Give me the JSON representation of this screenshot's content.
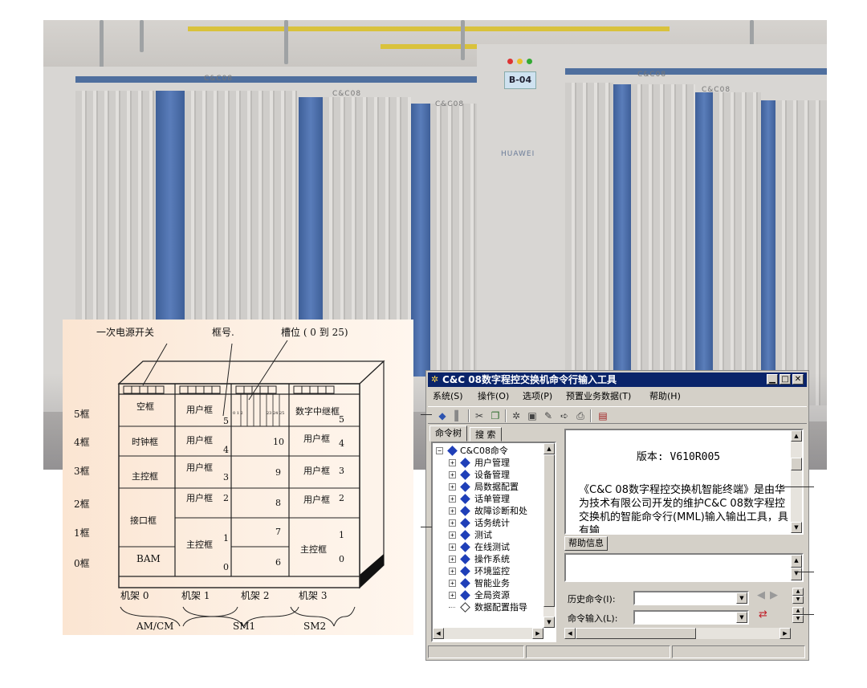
{
  "photo": {
    "cabinet_labels": [
      "C&C08",
      "C&C08",
      "C&C08",
      "C&C08",
      "C&C08"
    ],
    "rack_tag": "B-04",
    "brand": "HUAWEI"
  },
  "diagram": {
    "power_switch_label": "一次电源开关",
    "frame_no_label": "框号.",
    "slot_label": "槽位 ( 0 到 25)",
    "frame_rows": [
      "5框",
      "4框",
      "3框",
      "2框",
      "1框",
      "0框"
    ],
    "rack_labels": [
      "机架 0",
      "机架 1",
      "机架 2",
      "机架 3"
    ],
    "group_labels": [
      "AM/CM",
      "SM1",
      "SM2"
    ],
    "rack0": {
      "empty": "空框",
      "clock": "时钟框",
      "main_ctrl": "主控框",
      "interface": "接口框",
      "bam": "BAM"
    },
    "rack1": {
      "user5": "用户框",
      "n5": "5",
      "user4": "用户框",
      "n4": "4",
      "user3": "用户框",
      "n3": "3",
      "user2": "用户框",
      "n2": "2",
      "main_ctrl": "主控框",
      "n1": "1",
      "n0": "0"
    },
    "rack2": {
      "n10": "10",
      "n9": "9",
      "n8": "8",
      "n7": "7",
      "n6": "6",
      "slot_small": "0 1 2",
      "slot_small2": "23 24 25"
    },
    "rack3": {
      "trunk": "数字中继框",
      "n5": "5",
      "user4": "用户框",
      "n4": "4",
      "user3": "用户框",
      "n3": "3",
      "user2": "用户框",
      "n2": "2",
      "main_ctrl": "主控框",
      "n1": "1",
      "n0": "0"
    }
  },
  "window": {
    "title": "C&C 08数字程控交换机命令行输入工具",
    "menu": [
      "系统(S)",
      "操作(O)",
      "选项(P)",
      "预置业务数据(T)",
      "帮助(H)"
    ],
    "tabs": [
      "命令树",
      "搜 索"
    ],
    "tree_root": "C&C08命令",
    "tree_items": [
      "用户管理",
      "设备管理",
      "局数据配置",
      "话单管理",
      "故障诊断和处",
      "话务统计",
      "测试",
      "在线测试",
      "操作系统",
      "环境监控",
      "智能业务",
      "全局资源",
      "数据配置指导"
    ],
    "info_version": "版本: V610R005",
    "info_desc": "《C&C 08数字程控交换机智能终端》是由华为技术有限公司开发的维护C&C 08数字程控交换机的智能命令行(MML)输入输出工具，具有输",
    "help_tab": "帮助信息",
    "history_label": "历史命令(I):",
    "input_label": "命令输入(L):",
    "history_value": "",
    "input_value": ""
  }
}
